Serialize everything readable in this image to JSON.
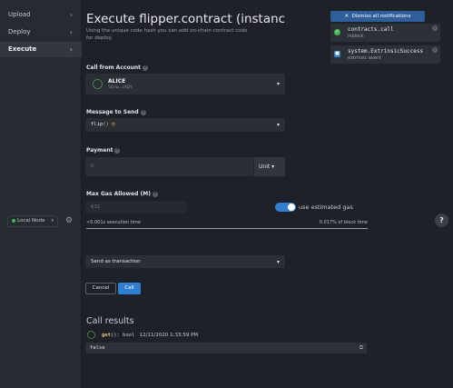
{
  "sidebar": {
    "items": [
      {
        "label": "Upload"
      },
      {
        "label": "Deploy"
      },
      {
        "label": "Execute"
      }
    ],
    "node_label": "Local Node"
  },
  "main": {
    "title": "Execute flipper.contract (instanc",
    "subtitle": "Using the unique code hash you can add on-chain contract code for deploy.",
    "call_from_label": "Call from Account",
    "account_name": "ALICE",
    "account_address": "5Grw...utQY",
    "message_label": "Message to Send",
    "message_value": "flip",
    "message_parens": "()",
    "payment_label": "Payment",
    "payment_placeholder": "0",
    "payment_unit": "Unit",
    "gas_label": "Max Gas Allowed (M)",
    "gas_placeholder": "631",
    "use_estimated_gas": "use estimated gas",
    "exec_time": "<0.001s execution time",
    "block_time": "0.017% of block time",
    "send_as": "Send as transaction",
    "cancel_label": "Cancel",
    "call_label": "Call",
    "results_title": "Call results",
    "result_fn": "get",
    "result_sig": "(): bool",
    "result_time": "12/11/2020 1:33:59 PM",
    "result_value": "false"
  },
  "notifications": {
    "dismiss_label": "Dismiss all notifications",
    "items": [
      {
        "title": "contracts.call",
        "status": "inblock"
      },
      {
        "title": "system.ExtrinsicSuccess",
        "status": "extrinsic event"
      }
    ]
  },
  "colors": {
    "accent": "#2f7fd1",
    "success": "#3fb950"
  }
}
